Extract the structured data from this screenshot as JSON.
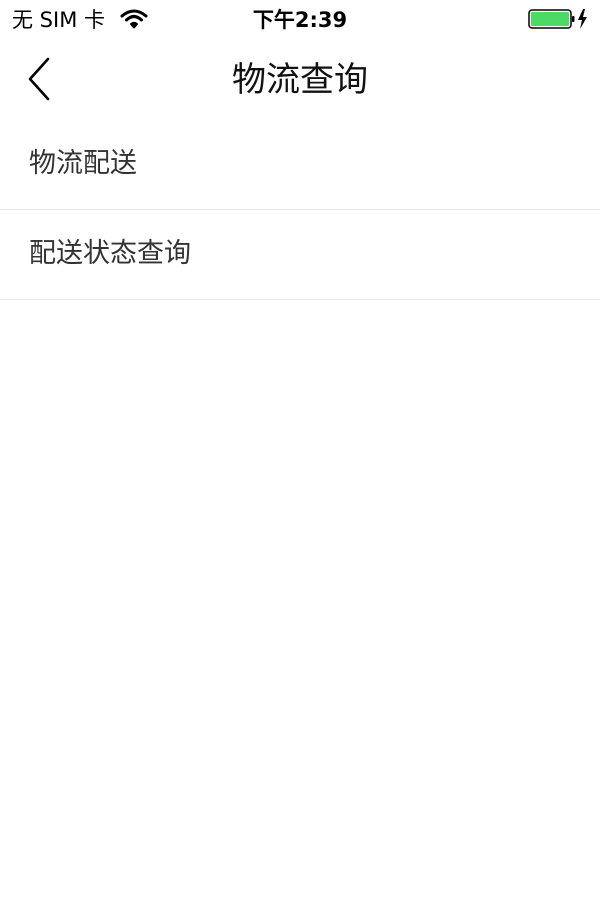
{
  "status_bar": {
    "carrier": "无 SIM 卡",
    "time": "下午2:39",
    "wifi_icon": "wifi-icon",
    "battery_icon": "battery-charging-icon",
    "battery_level": 1.0,
    "battery_color": "#4cd964"
  },
  "nav": {
    "back_icon": "chevron-left-icon",
    "title": "物流查询"
  },
  "menu": {
    "items": [
      {
        "label": "物流配送"
      },
      {
        "label": "配送状态查询"
      }
    ]
  },
  "colors": {
    "background": "#ffffff",
    "divider": "#e9e9e9",
    "label_text": "#333333",
    "title_text": "#111111"
  }
}
